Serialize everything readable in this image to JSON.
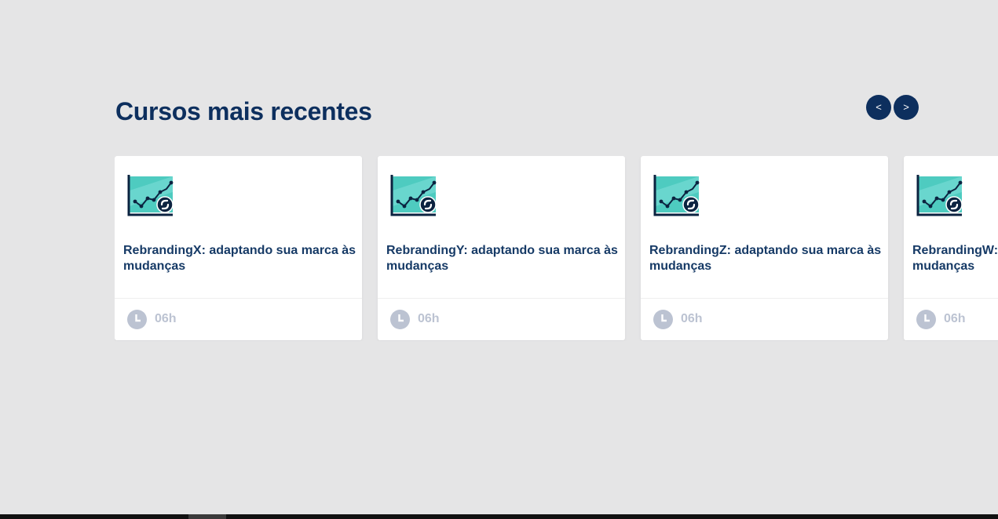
{
  "section": {
    "title": "Cursos mais recentes"
  },
  "carousel": {
    "prev_label": "<",
    "next_label": ">",
    "accent_color": "#0d2f5e"
  },
  "courses": [
    {
      "title": "RebrandingX: adaptando sua marca às mudanças",
      "duration": "06h",
      "icon": "chart-python-icon"
    },
    {
      "title": "RebrandingY: adaptando sua marca às mudanças",
      "duration": "06h",
      "icon": "chart-python-icon"
    },
    {
      "title": "RebrandingZ: adaptando sua marca às mudanças",
      "duration": "06h",
      "icon": "chart-python-icon"
    },
    {
      "title": "RebrandingW: adaptando sua marca às mudanças",
      "duration": "06h",
      "icon": "chart-python-icon"
    }
  ],
  "colors": {
    "background": "#e5e5e6",
    "title": "#0d2f5e",
    "card_title": "#163a66",
    "muted": "#bcc3d2",
    "icon_teal": "#4ecbc0"
  }
}
